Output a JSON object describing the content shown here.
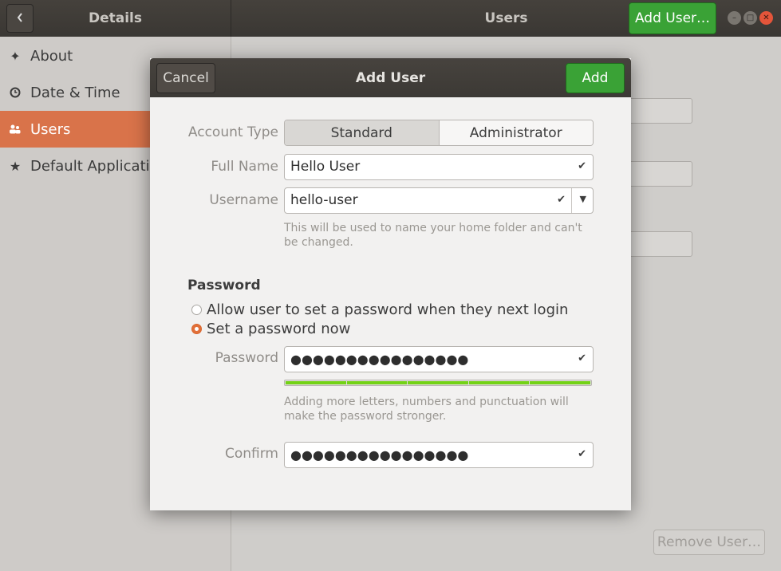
{
  "window": {
    "sidebar_title": "Details",
    "main_title": "Users",
    "add_user_button": "Add User…",
    "remove_user_button": "Remove User…",
    "window_controls": [
      "minimize",
      "maximize",
      "close"
    ]
  },
  "sidebar": {
    "items": [
      {
        "label": "About",
        "icon": "sparkle-icon"
      },
      {
        "label": "Date & Time",
        "icon": "clock-icon"
      },
      {
        "label": "Users",
        "icon": "users-icon",
        "active": true
      },
      {
        "label": "Default Applications",
        "icon": "star-icon"
      }
    ]
  },
  "dialog": {
    "title": "Add User",
    "cancel_label": "Cancel",
    "add_label": "Add",
    "account_type_label": "Account Type",
    "account_types": [
      "Standard",
      "Administrator"
    ],
    "account_type_selected": "Standard",
    "full_name_label": "Full Name",
    "full_name_value": "Hello User",
    "username_label": "Username",
    "username_value": "hello-user",
    "username_hint": "This will be used to name your home folder and can't be changed.",
    "password_section_title": "Password",
    "password_options": [
      {
        "label": "Allow user to set a password when they next login",
        "selected": false
      },
      {
        "label": "Set a password now",
        "selected": true
      }
    ],
    "password_label": "Password",
    "password_value": "●●●●●●●●●●●●●●●●",
    "password_strength": 1.0,
    "password_hint": "Adding more letters, numbers and punctuation will make the password stronger.",
    "confirm_label": "Confirm",
    "confirm_value": "●●●●●●●●●●●●●●●●"
  },
  "colors": {
    "accent_orange": "#d9734a",
    "add_green": "#3aa236",
    "strength_green": "#73d216",
    "headerbar": "#3c3935"
  }
}
